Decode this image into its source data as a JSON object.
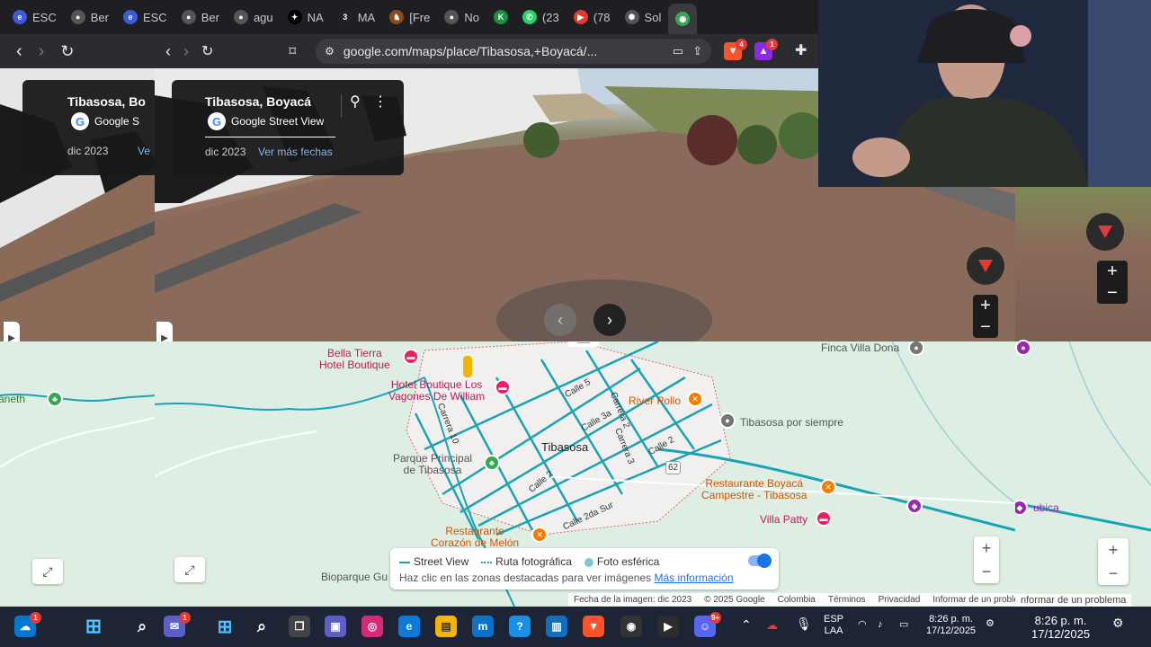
{
  "tabs": [
    {
      "title": "ESC",
      "color": "#3b5bdb",
      "glyph": "e"
    },
    {
      "title": "Ber",
      "color": "#555555",
      "glyph": "●"
    },
    {
      "title": "ESC",
      "color": "#3b5bdb",
      "glyph": "e"
    },
    {
      "title": "Ber",
      "color": "#555555",
      "glyph": "●"
    },
    {
      "title": "agu",
      "color": "#555555",
      "glyph": "●"
    },
    {
      "title": "NA",
      "color": "#000000",
      "glyph": "✦"
    },
    {
      "title": "MA",
      "color": "#222222",
      "glyph": "3"
    },
    {
      "title": "[Fre",
      "color": "#8a4b1e",
      "glyph": "♞"
    },
    {
      "title": "No",
      "color": "#555555",
      "glyph": "●"
    },
    {
      "title": "",
      "color": "#1a8f3c",
      "glyph": "K"
    },
    {
      "title": "(23",
      "color": "#25d366",
      "glyph": "✆"
    },
    {
      "title": "(78",
      "color": "#e53935",
      "glyph": "▶"
    },
    {
      "title": "Sol",
      "color": "#555555",
      "glyph": "✺"
    },
    {
      "title": "",
      "color": "#34a853",
      "glyph": "◉"
    }
  ],
  "browser": {
    "url": "google.com/maps/place/Tibasosa,+Boyacá/...",
    "ext_badge_1": "4",
    "ext_badge_2": "1"
  },
  "street_view_card": {
    "place": "Tibasosa, Boyacá",
    "provider": "Google Street View",
    "date": "dic 2023",
    "more_dates": "Ver más fechas"
  },
  "left_card": {
    "place": "Tibasosa, Bo",
    "provider": "Google S",
    "date": "dic 2023",
    "more": "Ve"
  },
  "map": {
    "town": "Tibasosa",
    "places": {
      "bella_tierra": "Bella Tierra\nHotel Boutique",
      "hotel_vagones": "Hotel Boutique Los\nVagones De William",
      "parque": "Parque Principal\nde Tibasosa",
      "river_pollo": "River Pollo",
      "tibasosa_siempre": "Tibasosa por siempre",
      "restaurante_boyaca": "Restaurante Boyacá\nCampestre - Tibasosa",
      "villa_patty": "Villa Patty",
      "restaurante_corazon": "Restaurante\nCorazón de Melón",
      "bioparque": "Bioparque Gu",
      "finca": "Finca Villa Dona",
      "ubica": "ubica",
      "aneth": "aneth"
    },
    "streets": {
      "calle5": "Calle 5",
      "carrera2": "Carrera 2",
      "calle3a": "Calle 3a",
      "carrera3": "Carrera 3",
      "calle2": "Calle 2",
      "carrera10": "Carrera 10",
      "calle2b": "Calle 2",
      "calle2da": "Calle 2da Sur",
      "route": "62"
    },
    "legend": {
      "street_view": "Street View",
      "photo_route": "Ruta fotográfica",
      "spherical": "Foto esférica",
      "hint": "Haz clic en las zonas destacadas para ver imágenes",
      "more_info": "Más información"
    },
    "attribution": {
      "image_date": "Fecha de la imagen: dic 2023",
      "copyright": "© 2025 Google",
      "country": "Colombia",
      "terms": "Términos",
      "privacy": "Privacidad",
      "report": "Informar de un problema",
      "report_right": "nformar de un problema"
    },
    "colors": {
      "sv_coverage": "#1aa3b5",
      "land": "#dfeee3",
      "town_area": "#f2f0ee"
    }
  },
  "taskbar": {
    "lang": "ESP",
    "layout": "LAA",
    "time": "8:26 p. m.",
    "date": "17/12/2025",
    "time_right": "8:26 p. m.",
    "date_right": "17/12/2025",
    "badge_left": "1",
    "badge_chat": "1",
    "badge_discord": "9+"
  }
}
